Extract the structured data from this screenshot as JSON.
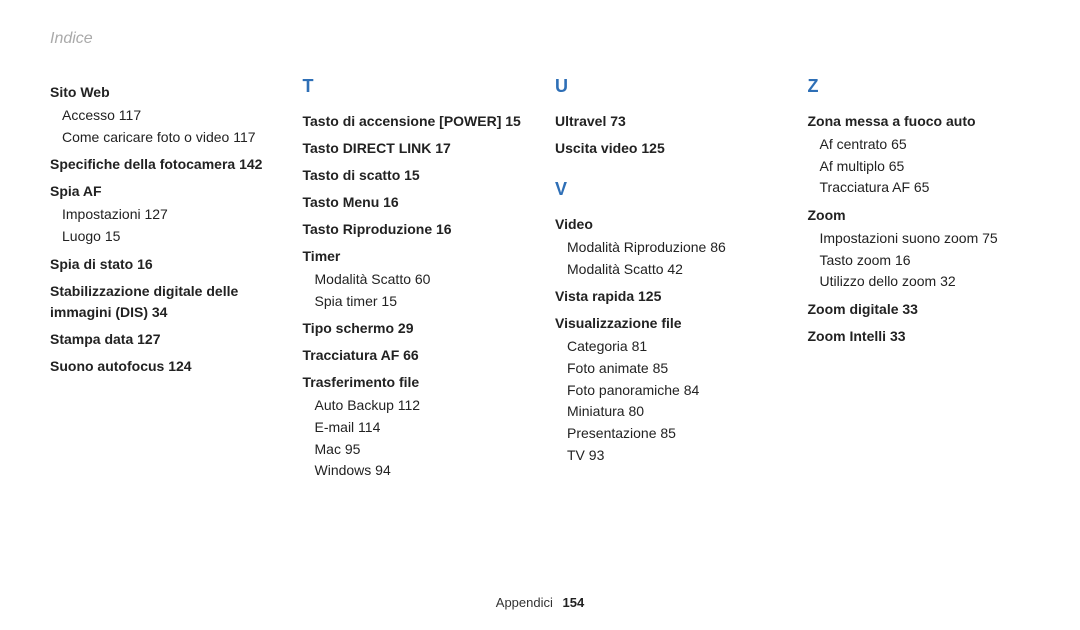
{
  "header": {
    "title": "Indice"
  },
  "footer": {
    "section": "Appendici",
    "page": "154"
  },
  "columns": [
    {
      "letter": null,
      "blocks": [
        {
          "bold": "Sito Web",
          "subs": [
            "Accesso  117",
            "Come caricare foto o video  117"
          ]
        },
        {
          "bold": "Specifiche della fotocamera  142",
          "subs": []
        },
        {
          "bold": "Spia AF",
          "subs": [
            "Impostazioni  127",
            "Luogo  15"
          ]
        },
        {
          "bold": "Spia di stato  16",
          "subs": []
        },
        {
          "bold": "Stabilizzazione digitale delle immagini (DIS)  34",
          "subs": []
        },
        {
          "bold": "Stampa data  127",
          "subs": []
        },
        {
          "bold": "Suono autofocus  124",
          "subs": []
        }
      ]
    },
    {
      "letter": "T",
      "blocks": [
        {
          "bold": "Tasto di accensione [POWER]  15",
          "subs": []
        },
        {
          "bold": "Tasto DIRECT LINK  17",
          "subs": []
        },
        {
          "bold": "Tasto di scatto  15",
          "subs": []
        },
        {
          "bold": "Tasto Menu  16",
          "subs": []
        },
        {
          "bold": "Tasto Riproduzione  16",
          "subs": []
        },
        {
          "bold": "Timer",
          "subs": [
            "Modalità Scatto  60",
            "Spia timer  15"
          ]
        },
        {
          "bold": "Tipo schermo  29",
          "subs": []
        },
        {
          "bold": "Tracciatura AF  66",
          "subs": []
        },
        {
          "bold": "Trasferimento file",
          "subs": [
            "Auto Backup  112",
            "E-mail  114",
            "Mac  95",
            "Windows  94"
          ]
        }
      ]
    },
    {
      "letter": "U",
      "blocks": [
        {
          "bold": "Ultravel  73",
          "subs": []
        },
        {
          "bold": "Uscita video  125",
          "subs": []
        }
      ],
      "letter2": "V",
      "blocks2": [
        {
          "bold": "Video",
          "subs": [
            "Modalità Riproduzione  86",
            "Modalità Scatto  42"
          ]
        },
        {
          "bold": "Vista rapida  125",
          "subs": []
        },
        {
          "bold": "Visualizzazione file",
          "subs": [
            "Categoria  81",
            "Foto animate  85",
            "Foto panoramiche  84",
            "Miniatura  80",
            "Presentazione  85",
            "TV  93"
          ]
        }
      ]
    },
    {
      "letter": "Z",
      "blocks": [
        {
          "bold": "Zona messa a fuoco auto",
          "subs": [
            "Af centrato  65",
            "Af multiplo  65",
            "Tracciatura AF  65"
          ]
        },
        {
          "bold": "Zoom",
          "subs": [
            "Impostazioni suono zoom  75",
            "Tasto zoom  16",
            "Utilizzo dello zoom  32"
          ]
        },
        {
          "bold": "Zoom digitale  33",
          "subs": []
        },
        {
          "bold": "Zoom Intelli  33",
          "subs": []
        }
      ]
    }
  ]
}
